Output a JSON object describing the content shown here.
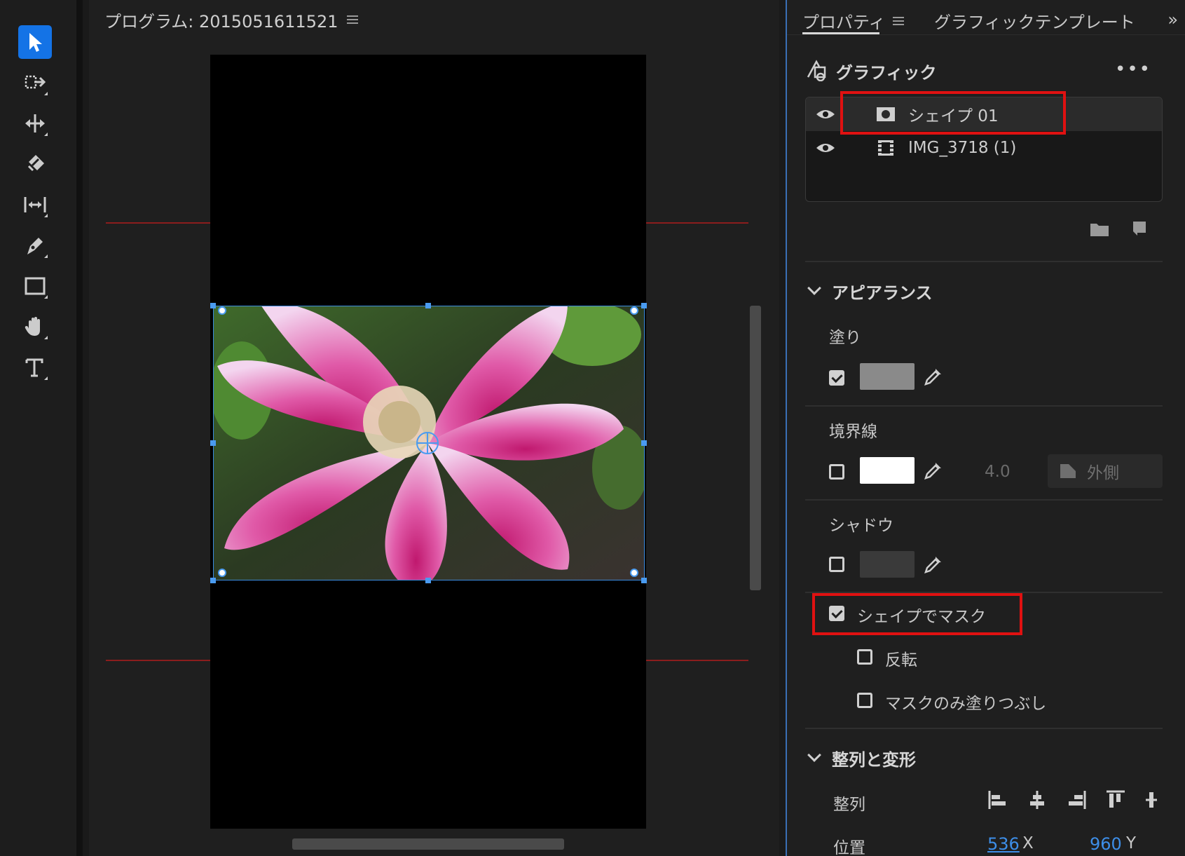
{
  "toolbar": {
    "tools": [
      {
        "name": "selection-tool",
        "icon": "arrow-icon",
        "active": true
      },
      {
        "name": "track-select-tool",
        "icon": "track-select-icon"
      },
      {
        "name": "ripple-edit-tool",
        "icon": "ripple-icon"
      },
      {
        "name": "razor-tool",
        "icon": "razor-icon"
      },
      {
        "name": "slip-tool",
        "icon": "slip-icon"
      },
      {
        "name": "pen-tool",
        "icon": "pen-icon"
      },
      {
        "name": "rectangle-tool",
        "icon": "rectangle-icon"
      },
      {
        "name": "hand-tool",
        "icon": "hand-icon"
      },
      {
        "name": "type-tool",
        "icon": "type-icon"
      }
    ]
  },
  "monitor": {
    "title": "プログラム: 201505161152​1"
  },
  "panel": {
    "tabs": [
      "プロパティ",
      "グラフィックテンプレート"
    ],
    "graphic_title": "グラフィック",
    "layers": [
      {
        "name": "シェイプ 01",
        "type": "shape",
        "selected": true
      },
      {
        "name": "IMG_3718 (1)",
        "type": "clip",
        "selected": false
      }
    ],
    "appearance": {
      "title": "アピアランス",
      "fill_label": "塗り",
      "fill_checked": true,
      "fill_color": "#8a8a8a",
      "stroke_label": "境界線",
      "stroke_checked": false,
      "stroke_color": "#ffffff",
      "stroke_width": "4.0",
      "stroke_position": "外側",
      "shadow_label": "シャドウ",
      "shadow_checked": false,
      "shadow_color": "#3a3a3a",
      "mask_label": "シェイプでマスク",
      "mask_checked": true,
      "invert_label": "反転",
      "invert_checked": false,
      "mask_fill_label": "マスクのみ塗りつぶし",
      "mask_fill_checked": false
    },
    "align_transform": {
      "title": "整列と変形",
      "align_label": "整列",
      "position_label": "位置",
      "x_value": "536",
      "x_axis": "X",
      "y_value": "960",
      "y_axis": "Y"
    }
  },
  "colors": {
    "accent": "#1473e6",
    "highlight": "#e01111",
    "link": "#3d8ee8"
  }
}
